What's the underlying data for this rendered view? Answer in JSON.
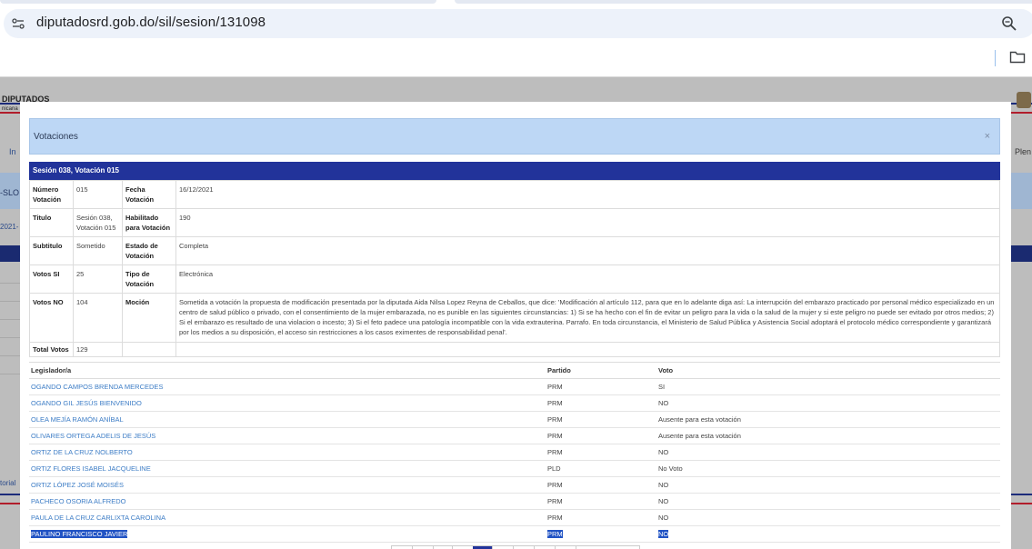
{
  "browser": {
    "url": "diputadosrd.gob.do/sil/sesion/131098"
  },
  "background": {
    "logo_text": "DIPUTADOS",
    "logo_sub": "nicana",
    "nav_fragment": "In",
    "nav_fragment_right": "Plen",
    "side_code": "-SLO",
    "side_date": "2021-",
    "side_link": "torial"
  },
  "modal": {
    "title": "Votaciones",
    "close_label": "×",
    "session_title": "Sesión 038, Votación 015",
    "info": {
      "numero_label": "Número Votación",
      "numero_value": "015",
      "fecha_label": "Fecha Votación",
      "fecha_value": "16/12/2021",
      "titulo_label": "Titulo",
      "titulo_value": "Sesión 038, Votación 015",
      "habilitado_label": "Habilitado para Votación",
      "habilitado_value": "190",
      "subtitulo_label": "Subtitulo",
      "subtitulo_value": "Sometido",
      "estado_label": "Estado de Votación",
      "estado_value": "Completa",
      "si_label": "Votos SI",
      "si_value": "25",
      "tipo_label": "Tipo de Votación",
      "tipo_value": "Electrónica",
      "no_label": "Votos NO",
      "no_value": "104",
      "mocion_label": "Moción",
      "mocion_value": "Sometida a votación la propuesta de modificación presentada por la diputada Aida Nilsa Lopez Reyna de Ceballos, que dice: 'Modificación al artículo 112, para que en lo adelante diga así: La interrupción del embarazo practicado por personal médico especializado en un centro de salud público o privado, con el consentimiento de la mujer embarazada, no es punible en las siguientes circunstancias: 1) Si se ha hecho con el fin de evitar un peligro para la vida o la salud de la mujer y si este peligro no puede ser evitado por otros medios; 2) Si el embarazo es resultado de una violacion o incesto; 3) Si el feto padece una patología incompatible con la vida extrauterina. Parrafo. En toda circunstancia, el Ministerio de Salud Pública y Asistencia Social adoptará el protocolo médico correspondiente y garantizará por los medios a su disposición, el acceso sin restricciones a los casos eximentes de responsabilidad penal'.",
      "total_label": "Total Votos",
      "total_value": "129"
    },
    "votes_headers": {
      "legislador": "Legislador/a",
      "partido": "Partido",
      "voto": "Voto"
    },
    "votes": [
      {
        "name": "OGANDO CAMPOS BRENDA MERCEDES",
        "party": "PRM",
        "vote": "SI"
      },
      {
        "name": "OGANDO GIL JESÚS BIENVENIDO",
        "party": "PRM",
        "vote": "NO"
      },
      {
        "name": "OLEA MEJÍA RAMÓN ANÍBAL",
        "party": "PRM",
        "vote": "Ausente para esta votación"
      },
      {
        "name": "OLIVARES ORTEGA ADELIS DE JESÚS",
        "party": "PRM",
        "vote": "Ausente para esta votación"
      },
      {
        "name": "ORTIZ DE LA CRUZ NOLBERTO",
        "party": "PRM",
        "vote": "NO"
      },
      {
        "name": "ORTIZ FLORES ISABEL JACQUELINE",
        "party": "PLD",
        "vote": "No Voto"
      },
      {
        "name": "ORTIZ LÓPEZ JOSÉ MOISÉS",
        "party": "PRM",
        "vote": "NO"
      },
      {
        "name": "PACHECO OSORIA ALFREDO",
        "party": "PRM",
        "vote": "NO"
      },
      {
        "name": "PAULA DE LA CRUZ CARLIXTA CAROLINA",
        "party": "PRM",
        "vote": "NO"
      },
      {
        "name": "PAULINO FRANCISCO JAVIER",
        "party": "PRM",
        "vote": "NO"
      }
    ]
  },
  "colors": {
    "header_bg": "#bdd7f5",
    "session_bar": "#22339a",
    "link": "#3d7dc6",
    "selection": "#2153c4"
  }
}
